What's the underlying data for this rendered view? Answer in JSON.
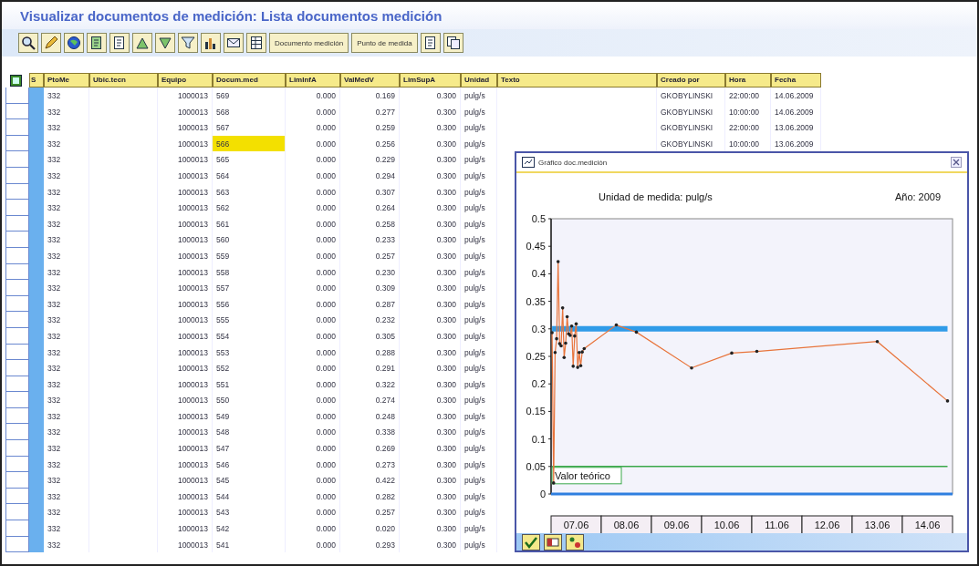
{
  "window": {
    "title": "Visualizar documentos de medición: Lista documentos medición"
  },
  "toolbar": [
    {
      "kind": "icon"
    },
    {
      "kind": "icon"
    },
    {
      "kind": "icon"
    },
    {
      "kind": "icon"
    },
    {
      "kind": "icon"
    },
    {
      "kind": "icon"
    },
    {
      "kind": "icon"
    },
    {
      "kind": "icon"
    },
    {
      "kind": "icon"
    },
    {
      "kind": "icon"
    },
    {
      "kind": "icon"
    },
    {
      "kind": "text",
      "label": "Documento medición"
    },
    {
      "kind": "text",
      "label": "Punto de medida"
    },
    {
      "kind": "icon"
    },
    {
      "kind": "icon"
    }
  ],
  "table": {
    "columns": [
      "S",
      "PtoMe",
      "Ubic.tecn",
      "Equipo",
      "Docum.med",
      "LimInfA",
      "ValMedV",
      "LimSupA",
      "Unidad",
      "Texto",
      "Creado por",
      "Hora",
      "Fecha"
    ],
    "rows": [
      {
        "pto": "332",
        "equipo": "1000013",
        "doc": "569",
        "liminf": "0.000",
        "valor": "0.169",
        "limsup": "0.300",
        "unidad": "pulg/s",
        "creado": "GKOBYLINSKI",
        "hora": "22:00:00",
        "fecha": "14.06.2009",
        "selected": false
      },
      {
        "pto": "332",
        "equipo": "1000013",
        "doc": "568",
        "liminf": "0.000",
        "valor": "0.277",
        "limsup": "0.300",
        "unidad": "pulg/s",
        "creado": "GKOBYLINSKI",
        "hora": "10:00:00",
        "fecha": "14.06.2009",
        "selected": false
      },
      {
        "pto": "332",
        "equipo": "1000013",
        "doc": "567",
        "liminf": "0.000",
        "valor": "0.259",
        "limsup": "0.300",
        "unidad": "pulg/s",
        "creado": "GKOBYLINSKI",
        "hora": "22:00:00",
        "fecha": "13.06.2009",
        "selected": false
      },
      {
        "pto": "332",
        "equipo": "1000013",
        "doc": "566",
        "liminf": "0.000",
        "valor": "0.256",
        "limsup": "0.300",
        "unidad": "pulg/s",
        "creado": "GKOBYLINSKI",
        "hora": "10:00:00",
        "fecha": "13.06.2009",
        "selected": true
      },
      {
        "pto": "332",
        "equipo": "1000013",
        "doc": "565",
        "liminf": "0.000",
        "valor": "0.229",
        "limsup": "0.300",
        "unidad": "pulg/s",
        "selected": false
      },
      {
        "pto": "332",
        "equipo": "1000013",
        "doc": "564",
        "liminf": "0.000",
        "valor": "0.294",
        "limsup": "0.300",
        "unidad": "pulg/s",
        "selected": false
      },
      {
        "pto": "332",
        "equipo": "1000013",
        "doc": "563",
        "liminf": "0.000",
        "valor": "0.307",
        "limsup": "0.300",
        "unidad": "pulg/s",
        "selected": false
      },
      {
        "pto": "332",
        "equipo": "1000013",
        "doc": "562",
        "liminf": "0.000",
        "valor": "0.264",
        "limsup": "0.300",
        "unidad": "pulg/s",
        "selected": false
      },
      {
        "pto": "332",
        "equipo": "1000013",
        "doc": "561",
        "liminf": "0.000",
        "valor": "0.258",
        "limsup": "0.300",
        "unidad": "pulg/s",
        "selected": false
      },
      {
        "pto": "332",
        "equipo": "1000013",
        "doc": "560",
        "liminf": "0.000",
        "valor": "0.233",
        "limsup": "0.300",
        "unidad": "pulg/s",
        "selected": false
      },
      {
        "pto": "332",
        "equipo": "1000013",
        "doc": "559",
        "liminf": "0.000",
        "valor": "0.257",
        "limsup": "0.300",
        "unidad": "pulg/s",
        "selected": false
      },
      {
        "pto": "332",
        "equipo": "1000013",
        "doc": "558",
        "liminf": "0.000",
        "valor": "0.230",
        "limsup": "0.300",
        "unidad": "pulg/s",
        "selected": false
      },
      {
        "pto": "332",
        "equipo": "1000013",
        "doc": "557",
        "liminf": "0.000",
        "valor": "0.309",
        "limsup": "0.300",
        "unidad": "pulg/s",
        "selected": false
      },
      {
        "pto": "332",
        "equipo": "1000013",
        "doc": "556",
        "liminf": "0.000",
        "valor": "0.287",
        "limsup": "0.300",
        "unidad": "pulg/s",
        "selected": false
      },
      {
        "pto": "332",
        "equipo": "1000013",
        "doc": "555",
        "liminf": "0.000",
        "valor": "0.232",
        "limsup": "0.300",
        "unidad": "pulg/s",
        "selected": false
      },
      {
        "pto": "332",
        "equipo": "1000013",
        "doc": "554",
        "liminf": "0.000",
        "valor": "0.305",
        "limsup": "0.300",
        "unidad": "pulg/s",
        "selected": false
      },
      {
        "pto": "332",
        "equipo": "1000013",
        "doc": "553",
        "liminf": "0.000",
        "valor": "0.288",
        "limsup": "0.300",
        "unidad": "pulg/s",
        "selected": false
      },
      {
        "pto": "332",
        "equipo": "1000013",
        "doc": "552",
        "liminf": "0.000",
        "valor": "0.291",
        "limsup": "0.300",
        "unidad": "pulg/s",
        "selected": false
      },
      {
        "pto": "332",
        "equipo": "1000013",
        "doc": "551",
        "liminf": "0.000",
        "valor": "0.322",
        "limsup": "0.300",
        "unidad": "pulg/s",
        "selected": false
      },
      {
        "pto": "332",
        "equipo": "1000013",
        "doc": "550",
        "liminf": "0.000",
        "valor": "0.274",
        "limsup": "0.300",
        "unidad": "pulg/s",
        "selected": false
      },
      {
        "pto": "332",
        "equipo": "1000013",
        "doc": "549",
        "liminf": "0.000",
        "valor": "0.248",
        "limsup": "0.300",
        "unidad": "pulg/s",
        "selected": false
      },
      {
        "pto": "332",
        "equipo": "1000013",
        "doc": "548",
        "liminf": "0.000",
        "valor": "0.338",
        "limsup": "0.300",
        "unidad": "pulg/s",
        "selected": false
      },
      {
        "pto": "332",
        "equipo": "1000013",
        "doc": "547",
        "liminf": "0.000",
        "valor": "0.269",
        "limsup": "0.300",
        "unidad": "pulg/s",
        "selected": false
      },
      {
        "pto": "332",
        "equipo": "1000013",
        "doc": "546",
        "liminf": "0.000",
        "valor": "0.273",
        "limsup": "0.300",
        "unidad": "pulg/s",
        "selected": false
      },
      {
        "pto": "332",
        "equipo": "1000013",
        "doc": "545",
        "liminf": "0.000",
        "valor": "0.422",
        "limsup": "0.300",
        "unidad": "pulg/s",
        "selected": false
      },
      {
        "pto": "332",
        "equipo": "1000013",
        "doc": "544",
        "liminf": "0.000",
        "valor": "0.282",
        "limsup": "0.300",
        "unidad": "pulg/s",
        "selected": false
      },
      {
        "pto": "332",
        "equipo": "1000013",
        "doc": "543",
        "liminf": "0.000",
        "valor": "0.257",
        "limsup": "0.300",
        "unidad": "pulg/s",
        "selected": false
      },
      {
        "pto": "332",
        "equipo": "1000013",
        "doc": "542",
        "liminf": "0.000",
        "valor": "0.020",
        "limsup": "0.300",
        "unidad": "pulg/s",
        "selected": false
      },
      {
        "pto": "332",
        "equipo": "1000013",
        "doc": "541",
        "liminf": "0.000",
        "valor": "0.293",
        "limsup": "0.300",
        "unidad": "pulg/s",
        "selected": false
      }
    ]
  },
  "chart_popup": {
    "title": "Gráfico doc.medición",
    "unit_label": "Unidad de medida: pulg/s",
    "year_label": "Año: 2009",
    "chart_data": {
      "type": "line",
      "x": [
        6.58,
        6.61,
        6.64,
        6.67,
        6.7,
        6.73,
        6.76,
        6.79,
        6.82,
        6.85,
        6.88,
        6.91,
        6.94,
        6.97,
        7.0,
        7.03,
        7.06,
        7.09,
        7.12,
        7.15,
        7.18,
        7.22,
        7.86,
        8.26,
        9.36,
        10.16,
        10.66,
        13.06,
        14.46
      ],
      "series": [
        {
          "color": "#e8743b",
          "values": [
            0.293,
            0.02,
            0.257,
            0.282,
            0.422,
            0.273,
            0.269,
            0.338,
            0.248,
            0.274,
            0.322,
            0.291,
            0.288,
            0.305,
            0.232,
            0.287,
            0.309,
            0.23,
            0.257,
            0.233,
            0.258,
            0.264,
            0.307,
            0.294,
            0.229,
            0.256,
            0.259,
            0.277,
            0.169
          ]
        },
        {
          "color": "#2f9be8",
          "values": [
            0.3,
            0.3,
            0.3,
            0.3,
            0.3,
            0.3,
            0.3,
            0.3,
            0.3,
            0.3,
            0.3,
            0.3,
            0.3,
            0.3,
            0.3,
            0.3,
            0.3,
            0.3,
            0.3,
            0.3,
            0.3,
            0.3,
            0.3,
            0.3,
            0.3,
            0.3,
            0.3,
            0.3,
            0.3
          ]
        },
        {
          "color": "#3aa84a",
          "values": [
            0.05,
            0.05,
            0.05,
            0.05,
            0.05,
            0.05,
            0.05,
            0.05,
            0.05,
            0.05,
            0.05,
            0.05,
            0.05,
            0.05,
            0.05,
            0.05,
            0.05,
            0.05,
            0.05,
            0.05,
            0.05,
            0.05,
            0.05,
            0.05,
            0.05,
            0.05,
            0.05,
            0.05,
            0.05
          ]
        }
      ],
      "xlim": [
        6.56,
        14.56
      ],
      "ylim": [
        0,
        0.5
      ],
      "xticks": [
        {
          "value": 7.06,
          "label": "07.06"
        },
        {
          "value": 8.06,
          "label": "08.06"
        },
        {
          "value": 9.06,
          "label": "09.06"
        },
        {
          "value": 10.06,
          "label": "10.06"
        },
        {
          "value": 11.06,
          "label": "11.06"
        },
        {
          "value": 12.06,
          "label": "12.06"
        },
        {
          "value": 13.06,
          "label": "13.06"
        },
        {
          "value": 14.06,
          "label": "14.06"
        }
      ],
      "yticks": [
        0,
        0.05,
        0.1,
        0.15,
        0.2,
        0.25,
        0.3,
        0.35,
        0.4,
        0.45,
        0.5
      ]
    },
    "reference_label": "Valor teórico"
  }
}
